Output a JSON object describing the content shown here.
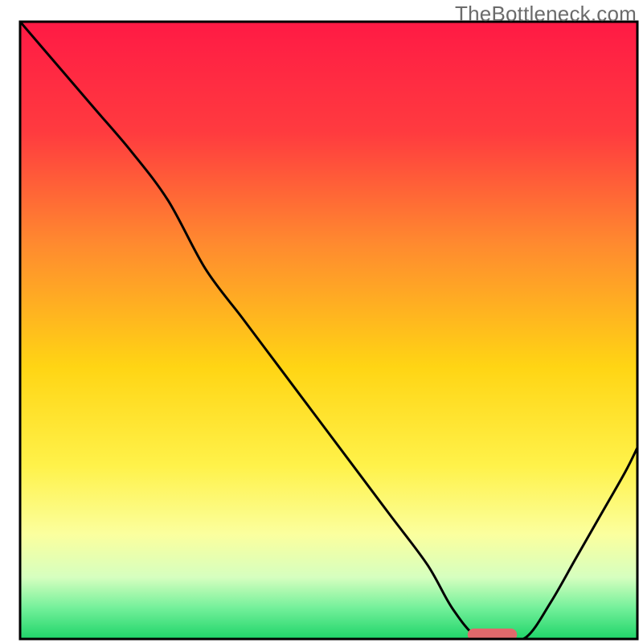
{
  "watermark": "TheBottleneck.com",
  "chart_data": {
    "type": "line",
    "title": "",
    "xlabel": "",
    "ylabel": "",
    "xlim": [
      0,
      100
    ],
    "ylim": [
      0,
      100
    ],
    "grid": false,
    "legend": false,
    "background": {
      "gradient_stops": [
        {
          "offset": 0.0,
          "color": "#ff1a45"
        },
        {
          "offset": 0.18,
          "color": "#ff3b3f"
        },
        {
          "offset": 0.36,
          "color": "#ff8a2f"
        },
        {
          "offset": 0.56,
          "color": "#ffd514"
        },
        {
          "offset": 0.72,
          "color": "#fff24a"
        },
        {
          "offset": 0.83,
          "color": "#fbff9e"
        },
        {
          "offset": 0.9,
          "color": "#d6ffbf"
        },
        {
          "offset": 0.95,
          "color": "#73f09a"
        },
        {
          "offset": 1.0,
          "color": "#1fd469"
        }
      ]
    },
    "series": [
      {
        "name": "curve",
        "color": "#000000",
        "width": 3,
        "x": [
          0,
          6,
          12,
          18,
          24,
          30,
          36,
          42,
          48,
          54,
          60,
          66,
          70,
          74,
          78,
          82,
          86,
          90,
          94,
          98,
          100
        ],
        "y": [
          100,
          93,
          86,
          79,
          71,
          60,
          52,
          44,
          36,
          28,
          20,
          12,
          5,
          0.3,
          0,
          0.3,
          6,
          13,
          20,
          27,
          31
        ]
      },
      {
        "name": "marker",
        "color": "#e0696b",
        "type": "capsule",
        "center": {
          "x": 76.5,
          "y": 0.7
        },
        "radius_x": 4.0,
        "radius_y": 1.0
      }
    ]
  },
  "frame": {
    "border_color": "#000000",
    "border_width": 3
  }
}
